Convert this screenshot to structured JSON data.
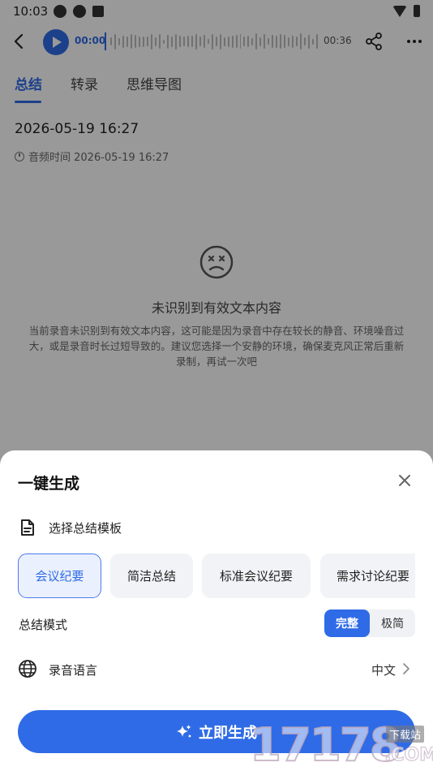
{
  "status_bar": {
    "time": "10:03"
  },
  "player": {
    "current_time": "00:00",
    "total_time": "00:36"
  },
  "tabs": [
    {
      "label": "总结"
    },
    {
      "label": "转录"
    },
    {
      "label": "思维导图"
    }
  ],
  "recording": {
    "date": "2026-05-19 16:27",
    "audio_time": "音频时间 2026-05-19 16:27"
  },
  "empty_state": {
    "title": "未识别到有效文本内容",
    "description": "当前录音未识别到有效文本内容，这可能是因为录音中存在较长的静音、环境噪音过大，或是录音时长过短导致的。建议您选择一个安静的环境，确保麦克风正常后重新录制，再试一次吧"
  },
  "sheet": {
    "title": "一键生成",
    "template_label": "选择总结模板",
    "templates": [
      {
        "label": "会议纪要",
        "selected": true
      },
      {
        "label": "简洁总结",
        "selected": false
      },
      {
        "label": "标准会议纪要",
        "selected": false
      },
      {
        "label": "需求讨论纪要",
        "selected": false
      }
    ],
    "mode_label": "总结模式",
    "modes": [
      {
        "label": "完整",
        "selected": true
      },
      {
        "label": "极简",
        "selected": false
      }
    ],
    "language_label": "录音语言",
    "language_value": "中文",
    "generate_label": "立即生成"
  },
  "watermark": {
    "number": "17178",
    "badge": "下载站",
    "suffix": ".COM"
  },
  "colors": {
    "accent": "#2f6be6",
    "chip_bg": "#f2f3f6",
    "selected_chip_bg": "#eaf0fd"
  }
}
